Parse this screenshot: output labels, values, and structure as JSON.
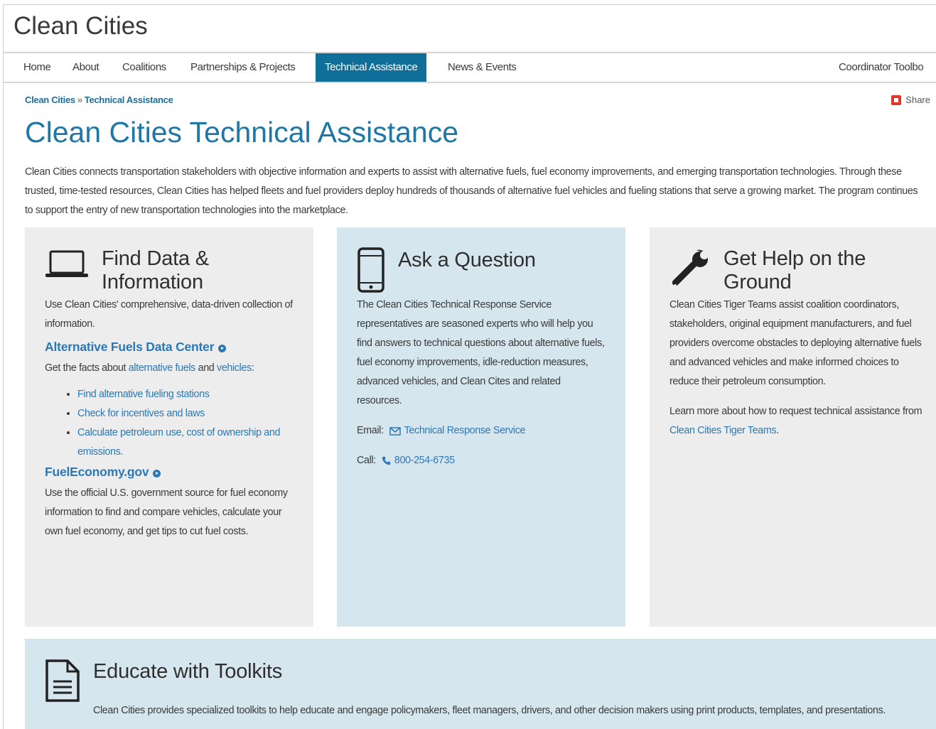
{
  "site": {
    "title": "Clean Cities"
  },
  "nav": {
    "items": [
      "Home",
      "About",
      "Coalitions",
      "Partnerships & Projects",
      "Technical Assistance",
      "News & Events",
      "Coordinator Toolbo"
    ],
    "active": "Technical Assistance"
  },
  "breadcrumb": {
    "items": [
      "Clean Cities",
      "Technical Assistance"
    ],
    "separator": "»"
  },
  "share": {
    "label": "Share"
  },
  "page": {
    "title": "Clean Cities Technical Assistance",
    "intro": "Clean Cities connects transportation stakeholders with objective information and experts to assist with alternative fuels, fuel economy improvements, and emerging transportation technologies. Through these trusted, time-tested resources, Clean Cities has helped fleets and fuel providers deploy hundreds of thousands of alternative fuel vehicles and fueling stations that serve a growing market. The program continues to support the entry of new transportation technologies into the marketplace."
  },
  "cards": {
    "find_data": {
      "title": "Find Data & Information",
      "intro": "Use Clean Cities' comprehensive, data-driven collection of information.",
      "afdc_title": "Alternative Fuels Data Center",
      "afdc_text_pre": "Get the facts about ",
      "afdc_link1": "alternative fuels",
      "afdc_text_mid": " and ",
      "afdc_link2": "vehicles",
      "afdc_text_post": ":",
      "bullets": [
        "Find alternative fueling stations",
        "Check for incentives and laws",
        "Calculate petroleum use, cost of ownership and emissions."
      ],
      "fe_title": "FuelEconomy.gov",
      "fe_text": "Use the official U.S. government source for fuel economy information to find and compare vehicles, calculate your own fuel economy, and get tips to cut fuel costs."
    },
    "ask": {
      "title": "Ask a Question",
      "text": "The Clean Cities Technical Response Service representatives are seasoned experts who will help you find answers to technical questions about alternative fuels, fuel economy improvements, idle-reduction measures, advanced vehicles, and Clean Cites and related resources.",
      "email_label": "Email:",
      "email_link": "Technical Response Service",
      "call_label": "Call:",
      "phone": "800-254-6735"
    },
    "help": {
      "title": "Get Help on the Ground",
      "text": "Clean Cities Tiger Teams assist coalition coordinators, stakeholders, original equipment manufacturers, and fuel providers overcome obstacles to deploying alternative fuels and advanced vehicles and make informed choices to reduce their petroleum consumption.",
      "more_pre": "Learn more about how to request technical assistance from ",
      "more_link": "Clean Cities Tiger Teams",
      "more_post": "."
    }
  },
  "toolkits": {
    "title": "Educate with Toolkits",
    "text": "Clean Cities provides specialized toolkits to help educate and engage policymakers, fleet managers, drivers, and other decision makers using print products, templates, and presentations."
  },
  "icons": {
    "laptop": "laptop-icon",
    "phone": "mobile-phone-icon",
    "wrench": "wrench-icon",
    "document": "document-icon",
    "share": "share-icon",
    "envelope": "envelope-icon",
    "telephone": "telephone-icon"
  },
  "colors": {
    "accent": "#106f99",
    "title": "#1f77a5",
    "link": "#2b78b6",
    "card_gray": "#ededed",
    "card_blue": "#d6e6ef"
  }
}
